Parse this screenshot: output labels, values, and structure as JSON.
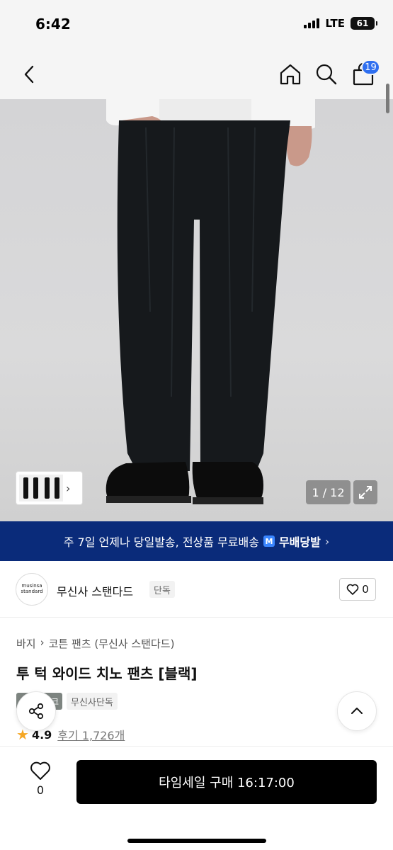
{
  "status_bar": {
    "time": "6:42",
    "network": "LTE",
    "battery": "61"
  },
  "header": {
    "cart_count": "19"
  },
  "gallery": {
    "counter": "1 / 12"
  },
  "promo": {
    "text": "주 7일 언제나 당일발송, 전상품 무료배송",
    "badge": "M",
    "brand": "무배당발"
  },
  "brand": {
    "logo_line1": "musinsa",
    "logo_line2": "standard",
    "name": "무신사 스탠다드",
    "tag": "단독",
    "likes": "0"
  },
  "product": {
    "breadcrumb": [
      "바지",
      "코튼 팬츠 (무신사 스탠다드)"
    ],
    "title": "투 턱 와이드 치노 팬츠 [블랙]",
    "tag_dark": "크",
    "tag_light": "무신사단독",
    "rating": "4.9",
    "reviews": "후기 1,726개"
  },
  "bottom": {
    "wish_count": "0",
    "buy_label": "타임세일 구매 16:17:00"
  },
  "colors": {
    "promo_bg": "#0a2b7a",
    "badge": "#2f6ff0",
    "star": "#f5a623"
  }
}
